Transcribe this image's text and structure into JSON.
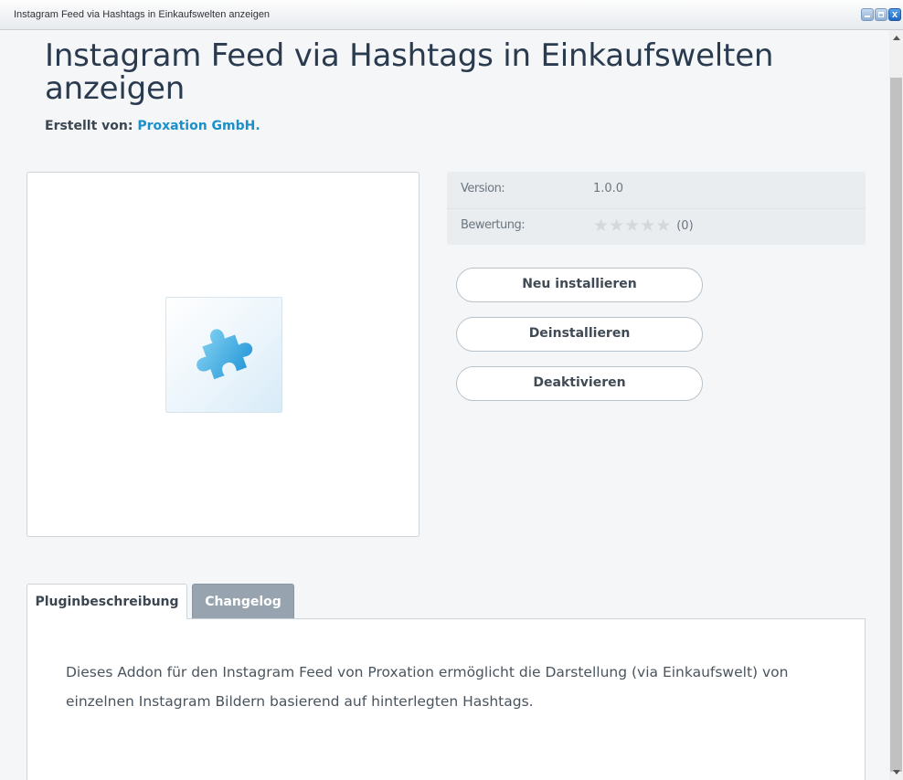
{
  "window": {
    "title": "Instagram Feed via Hashtags in Einkaufswelten anzeigen",
    "controls": {
      "minimize_icon": "minimize-icon",
      "maximize_icon": "maximize-icon",
      "close_label": "x"
    }
  },
  "header": {
    "title": "Instagram Feed via Hashtags in Einkaufswelten anzeigen",
    "creator_label": "Erstellt von:",
    "creator_name": "Proxation GmbH",
    "creator_suffix": "."
  },
  "plugin_image": {
    "icon": "puzzle-icon",
    "colors": {
      "light": "#7fd0f0",
      "dark": "#2a9ed8"
    }
  },
  "info": {
    "version_label": "Version:",
    "version_value": "1.0.0",
    "rating_label": "Bewertung:",
    "rating_stars": 0,
    "rating_max": 5,
    "rating_count": "(0)"
  },
  "actions": {
    "reinstall_label": "Neu installieren",
    "uninstall_label": "Deinstallieren",
    "deactivate_label": "Deaktivieren"
  },
  "tabs": [
    {
      "label": "Pluginbeschreibung",
      "active": true
    },
    {
      "label": "Changelog",
      "active": false
    }
  ],
  "description": "Dieses Addon für den Instagram Feed von Proxation ermöglicht die Darstellung (via Einkaufswelt) von einzelnen Instagram Bildern basierend auf hinterlegten Hashtags.",
  "colors": {
    "accent": "#1b8fc9",
    "title_text": "#2a3a4f",
    "inactive_tab": "#97a4af"
  }
}
